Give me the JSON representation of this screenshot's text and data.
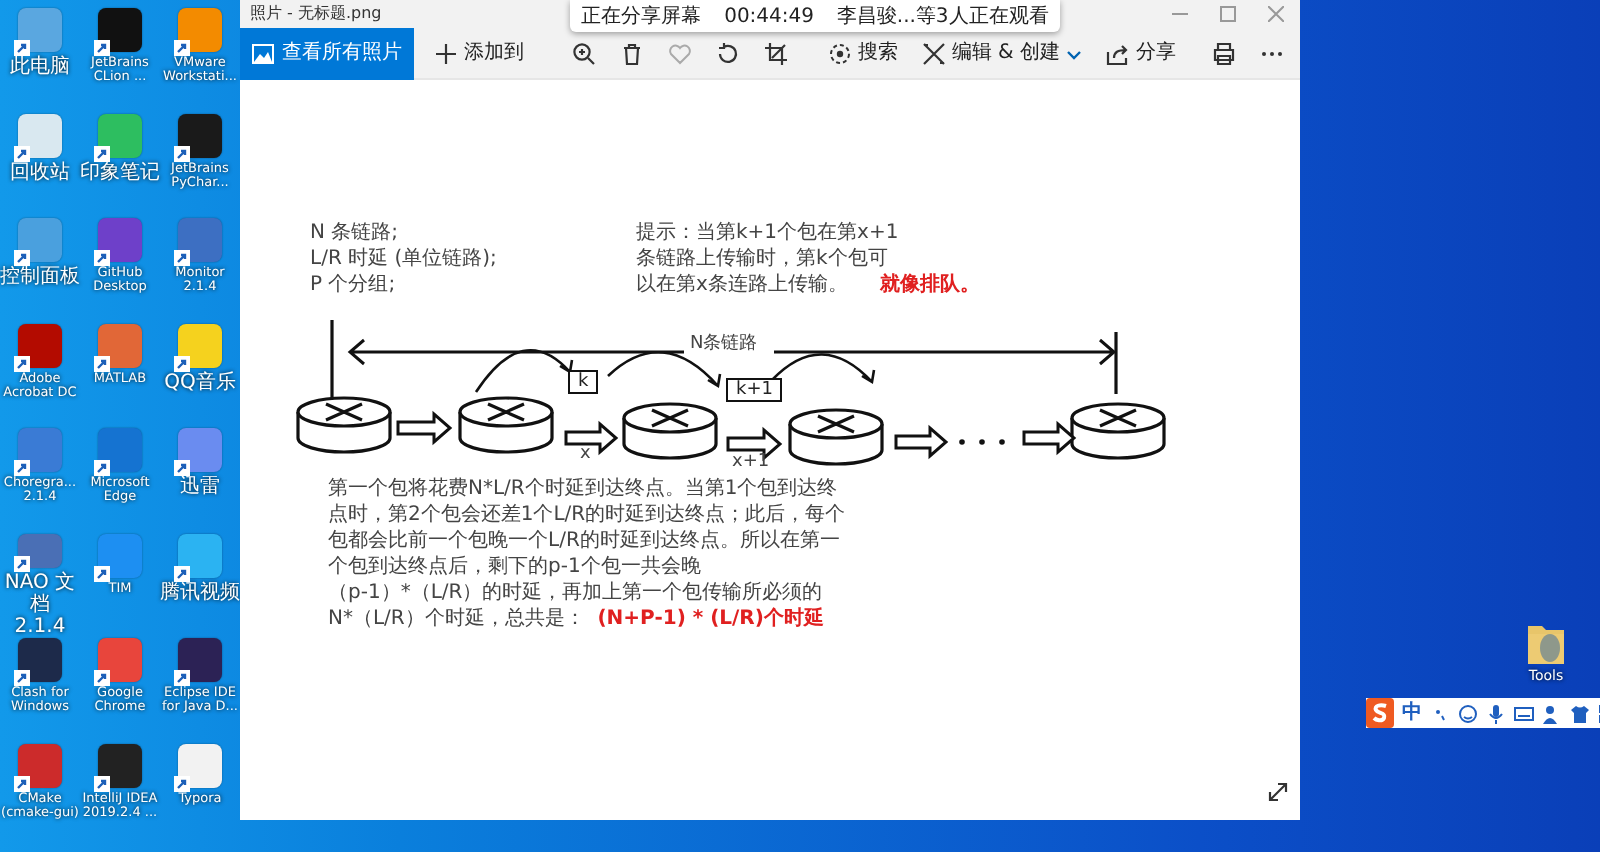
{
  "desktop_icons": [
    {
      "label": "此电脑",
      "color": "#5aa7e0"
    },
    {
      "label": "JetBrains\nCLion ...",
      "color": "#111111"
    },
    {
      "label": "VMware\nWorkstati...",
      "color": "#f38b00"
    },
    {
      "label": "回收站",
      "color": "#d9e8f0"
    },
    {
      "label": "印象笔记",
      "color": "#2dbe60"
    },
    {
      "label": "JetBrains\nPyChar...",
      "color": "#1a1a1a"
    },
    {
      "label": "控制面板",
      "color": "#4aa0de"
    },
    {
      "label": "GitHub\nDesktop",
      "color": "#6e40c9"
    },
    {
      "label": "Monitor\n2.1.4",
      "color": "#3d6fc2"
    },
    {
      "label": "Adobe\nAcrobat DC",
      "color": "#b30b00"
    },
    {
      "label": "MATLAB",
      "color": "#e16737"
    },
    {
      "label": "QQ音乐",
      "color": "#f5d21e"
    },
    {
      "label": "Choregra...\n2.1.4",
      "color": "#3a7bd5"
    },
    {
      "label": "Microsoft\nEdge",
      "color": "#1573d1"
    },
    {
      "label": "迅雷",
      "color": "#6a8cf0"
    },
    {
      "label": "NAO 文档\n2.1.4",
      "color": "#4a6fb5"
    },
    {
      "label": "TIM",
      "color": "#1d8ff2"
    },
    {
      "label": "腾讯视频",
      "color": "#2bb3f2"
    },
    {
      "label": "Clash for\nWindows",
      "color": "#1d2a4a"
    },
    {
      "label": "Google\nChrome",
      "color": "#e8453c"
    },
    {
      "label": "Eclipse IDE\nfor Java D...",
      "color": "#2c2255"
    },
    {
      "label": "CMake\n(cmake-gui)",
      "color": "#cc2b2b"
    },
    {
      "label": "IntelliJ IDEA\n2019.2.4 ...",
      "color": "#222222"
    },
    {
      "label": "Typora",
      "color": "#f2f2f2"
    }
  ],
  "window": {
    "title": "照片 - 无标题.png"
  },
  "share_banner": {
    "status": "正在分享屏幕",
    "time": "00:44:49",
    "viewers": "李昌骏...等3人正在观看"
  },
  "toolbar": {
    "view_all": "查看所有照片",
    "add_to": "添加到",
    "search": "搜索",
    "edit_create": "编辑 & 创建",
    "share": "分享"
  },
  "image": {
    "given": [
      "N 条链路;",
      "L/R 时延 (单位链路);",
      "P 个分组;"
    ],
    "hint": [
      "提示：当第k+1个包在第x+1",
      "条链路上传输时，第k个包可",
      "以在第x条连路上传输。"
    ],
    "note": "就像排队。",
    "link_label": "N条链路",
    "packets": [
      "k",
      "k+1"
    ],
    "links": [
      "x",
      "x+1"
    ],
    "explanation": [
      "第一个包将花费N*L/R个时延到达终点。当第1个包到达终",
      "点时，第2个包会还差1个L/R的时延到达终点；此后，每个",
      "包都会比前一个包晚一个L/R的时延到达终点。所以在第一",
      "个包到达终点后，剩下的p-1个包一共会晚",
      "（p-1）*（L/R）的时延，再加上第一个包传输所必须的",
      "N*（L/R）个时延，总共是："
    ],
    "result": "(N+P-1) * (L/R)个时延"
  },
  "desktop_folder": {
    "label": "Tools"
  },
  "ime_toolbar": {
    "mode": "中"
  }
}
